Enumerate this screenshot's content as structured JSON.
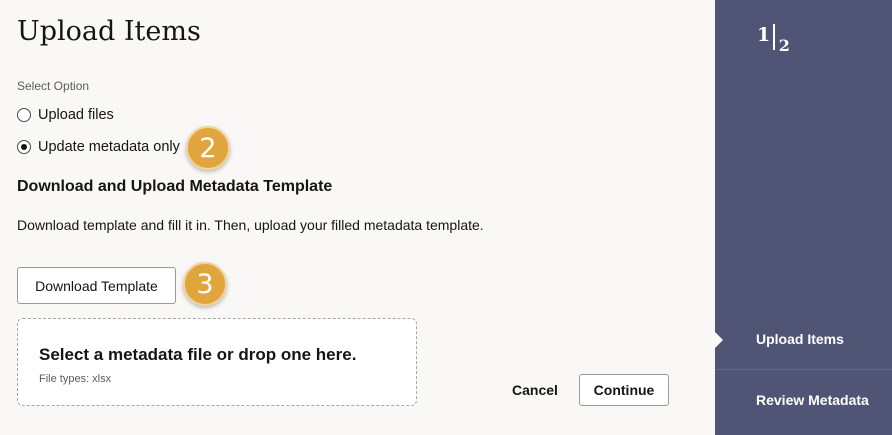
{
  "header": {
    "title": "Upload Items"
  },
  "options": {
    "label": "Select Option",
    "items": [
      {
        "label": "Upload files",
        "checked": false
      },
      {
        "label": "Update metadata only",
        "checked": true
      }
    ]
  },
  "callouts": {
    "step2": "2",
    "step3": "3"
  },
  "template_section": {
    "heading": "Download and Upload Metadata Template",
    "description": "Download template and fill it in. Then, upload your filled metadata template.",
    "download_label": "Download Template"
  },
  "dropzone": {
    "title": "Select a metadata file or drop one here.",
    "subtitle": "File types: xlsx"
  },
  "footer": {
    "cancel_label": "Cancel",
    "continue_label": "Continue"
  },
  "sidebar": {
    "step_current": "1",
    "step_total": "2",
    "steps": [
      {
        "label": "Upload Items",
        "active": true
      },
      {
        "label": "Review Metadata",
        "active": false
      }
    ]
  },
  "colors": {
    "sidebar": "#505575",
    "callout": "#e0a53c",
    "background": "#f9f8f6"
  }
}
